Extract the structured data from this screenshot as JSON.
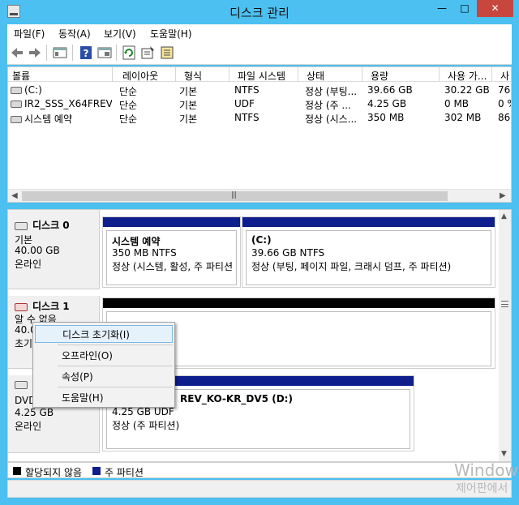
{
  "window": {
    "title": "디스크 관리",
    "minimize": "—",
    "maximize": "□",
    "close": "✕"
  },
  "menu": [
    "파일(F)",
    "동작(A)",
    "보기(V)",
    "도움말(H)"
  ],
  "toolbar_icons": [
    "back-icon",
    "forward-icon",
    "console-tree-icon",
    "help-icon",
    "properties-icon",
    "refresh-icon",
    "settings-icon",
    "rescan-icon"
  ],
  "volume_list": {
    "columns": [
      "볼륨",
      "레이아웃",
      "형식",
      "파일 시스템",
      "상태",
      "용량",
      "사용 가...",
      "사"
    ],
    "rows": [
      [
        "(C:)",
        "단순",
        "기본",
        "NTFS",
        "정상 (부팅...",
        "39.66 GB",
        "30.22 GB",
        "76"
      ],
      [
        "IR2_SSS_X64FREV...",
        "단순",
        "기본",
        "UDF",
        "정상 (주 ...",
        "4.25 GB",
        "0 MB",
        "0 %"
      ],
      [
        "시스템 예약",
        "단순",
        "기본",
        "NTFS",
        "정상 (시스...",
        "350 MB",
        "302 MB",
        "86"
      ]
    ]
  },
  "disks": [
    {
      "name": "디스크 0",
      "type": "기본",
      "size": "40.00 GB",
      "status": "온라인",
      "partitions": [
        {
          "name": "시스템 예약",
          "size": "350 MB NTFS",
          "status": "정상 (시스템, 활성, 주 파티션"
        },
        {
          "name": "(C:)",
          "size": "39.66 GB NTFS",
          "status": "정상 (부팅, 페이지 파일, 크래시 덤프, 주 파티션)"
        }
      ]
    },
    {
      "name": "디스크 1",
      "type": "알 수 없음",
      "size": "40.0",
      "status": "초기"
    },
    {
      "name": "",
      "type": "DVD",
      "size": "4.25 GB",
      "status": "온라인",
      "partitions": [
        {
          "name": "REV_KO-KR_DV5  (D:)",
          "size": "4.25 GB UDF",
          "status": "정상 (주 파티션)"
        }
      ]
    }
  ],
  "context_menu": [
    "디스크 초기화(I)",
    "오프라인(O)",
    "속성(P)",
    "도움말(H)"
  ],
  "legend": [
    {
      "label": "할당되지 않음",
      "color": "#000000"
    },
    {
      "label": "주 파티션",
      "color": "#0e1e8c"
    }
  ],
  "watermark": {
    "line1": "Window",
    "line2": "제어판에서"
  },
  "colors": {
    "titlebar": "#4cc0f0",
    "primary_partition": "#0e1e8c",
    "unallocated": "#000000",
    "close_button": "#c7463d"
  }
}
